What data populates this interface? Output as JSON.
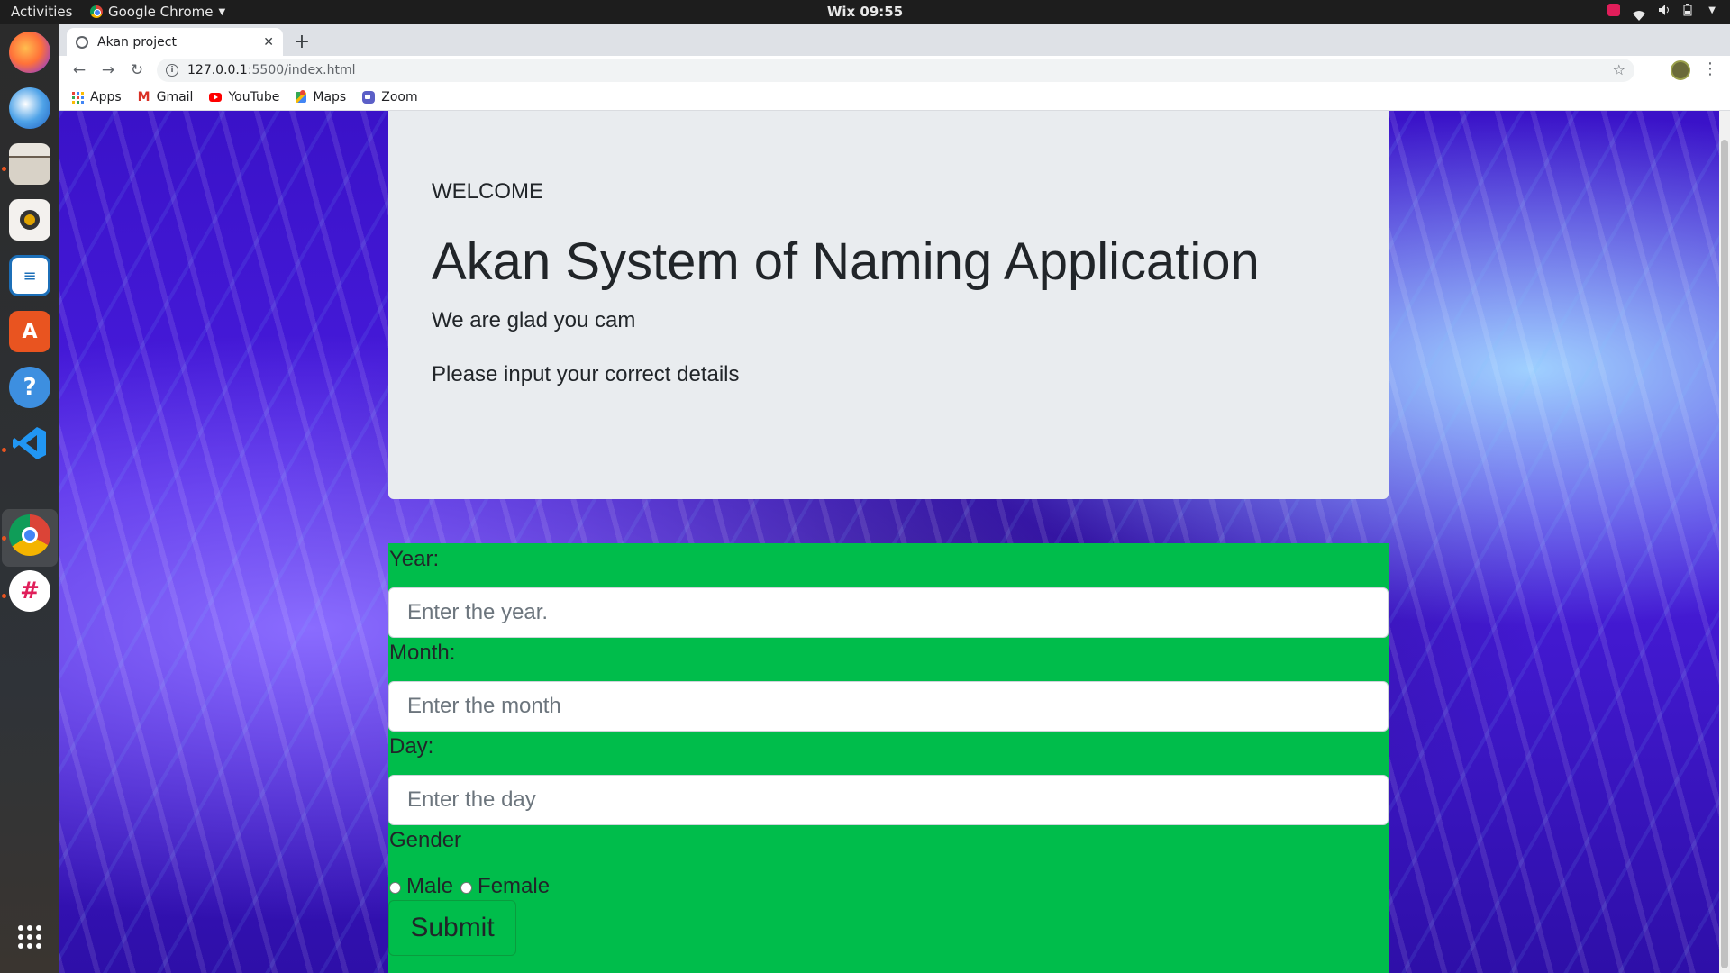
{
  "system": {
    "activities": "Activities",
    "app_name": "Google Chrome",
    "clock": "Wix 09:55"
  },
  "browser": {
    "tab_title": "Akan project",
    "url_host": "127.0.0.1",
    "url_path": ":5500/index.html",
    "bookmarks": [
      {
        "label": "Apps"
      },
      {
        "label": "Gmail"
      },
      {
        "label": "YouTube"
      },
      {
        "label": "Maps"
      },
      {
        "label": "Zoom"
      }
    ]
  },
  "hero": {
    "welcome": "WELCOME",
    "title": "Akan System of Naming Application",
    "glad": "We are glad you cam",
    "input_msg": "Please input your correct details"
  },
  "form": {
    "year_label": "Year:",
    "year_placeholder": "Enter the year.",
    "month_label": "Month:",
    "month_placeholder": "Enter the month",
    "day_label": "Day:",
    "day_placeholder": "Enter the day",
    "gender_label": "Gender",
    "male_label": "Male",
    "female_label": "Female",
    "submit_label": "Submit"
  },
  "colors": {
    "form_background": "#00bd4b",
    "hero_background": "#e9ecef",
    "page_background": "#3a12c8"
  }
}
